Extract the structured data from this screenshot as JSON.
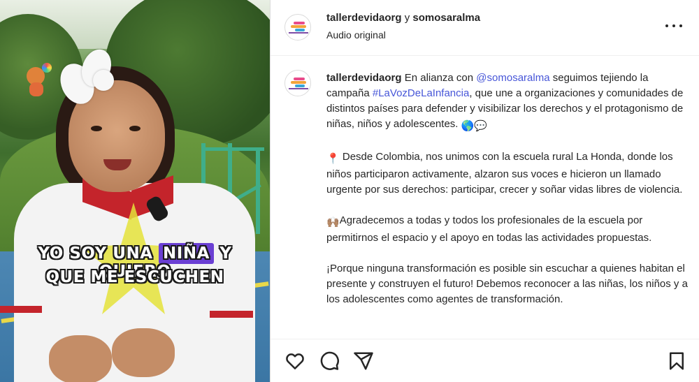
{
  "video": {
    "caption_line1_before": "YO SOY UNA ",
    "caption_line1_highlight": "NIÑA",
    "caption_line1_after": " Y QUIERO",
    "caption_line2": "QUE ME ESCUCHEN",
    "highlight_color": "#6a3fd3"
  },
  "header": {
    "user1": "tallerdevidaorg",
    "joiner": " y ",
    "user2": "somosaralma",
    "audio": "Audio original",
    "more_icon": "more-horizontal-icon"
  },
  "post": {
    "username": "tallerdevidaorg",
    "p1_a": " En alianza con ",
    "p1_mention": "@somosaralma",
    "p1_b": " seguimos tejiendo la campaña ",
    "p1_hashtag": "#LaVozDeLaInfancia",
    "p1_c": ", que une a organizaciones y comunidades de distintos países para defender y visibilizar los derechos y el protagonismo de niñas, niños y adolescentes. ",
    "p1_emoji": "🌎💬",
    "p2_emoji": "📍",
    "p2": " Desde Colombia, nos unimos con la escuela rural La Honda, donde los niños participaron activamente, alzaron sus voces e hicieron un llamado urgente por sus derechos: participar, crecer y soñar vidas libres de violencia.",
    "p3_emoji": "🙌🏽",
    "p3": "Agradecemos a todas y todos los profesionales de la escuela por permitirnos el espacio y el apoyo en todas las actividades propuestas.",
    "p4": "¡Porque ninguna transformación es posible sin escuchar a quienes habitan el presente y construyen el futuro! Debemos reconocer a las niñas, los niños y a los adolescentes como agentes de transformación."
  },
  "actions": {
    "like_icon": "heart-icon",
    "comment_icon": "comment-icon",
    "share_icon": "share-icon",
    "save_icon": "bookmark-icon"
  },
  "colors": {
    "link": "#4756d8",
    "text": "#262626",
    "border": "#dbdbdb"
  }
}
